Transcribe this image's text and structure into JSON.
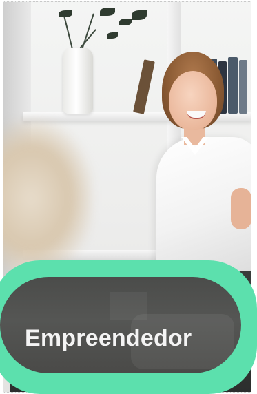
{
  "card": {
    "label": "Empreendedor"
  },
  "colors": {
    "pill_accent": "#5ce0ad",
    "pill_fill": "#4f504e",
    "label_text": "#f4f4f4"
  }
}
